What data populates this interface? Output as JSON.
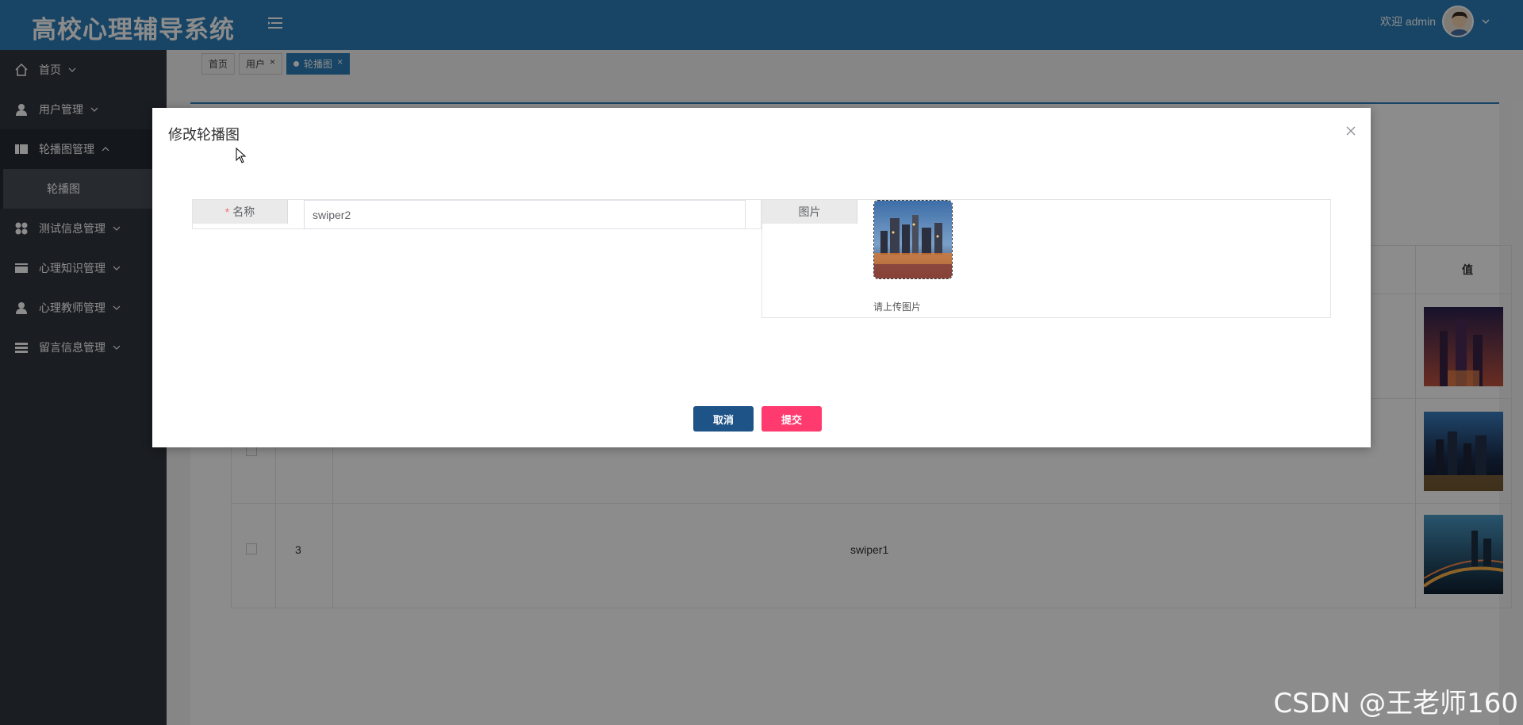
{
  "header": {
    "title": "高校心理辅导系统",
    "welcome": "欢迎 admin"
  },
  "sidebar": {
    "items": [
      {
        "label": "首页"
      },
      {
        "label": "用户管理"
      },
      {
        "label": "轮播图管理"
      },
      {
        "label": "测试信息管理"
      },
      {
        "label": "心理知识管理"
      },
      {
        "label": "心理教师管理"
      },
      {
        "label": "留言信息管理"
      }
    ],
    "sub_item": "轮播图"
  },
  "tabs": [
    {
      "label": "首页"
    },
    {
      "label": "用户"
    },
    {
      "label": "轮播图"
    }
  ],
  "table": {
    "value_header": "值",
    "rows": [
      {
        "num": "",
        "name": ""
      },
      {
        "num": "",
        "name": ""
      },
      {
        "num": "3",
        "name": "swiper1"
      }
    ]
  },
  "modal": {
    "title": "修改轮播图",
    "name_label": "名称",
    "name_value": "swiper2",
    "image_label": "图片",
    "upload_tip": "请上传图片",
    "cancel_label": "取消",
    "submit_label": "提交"
  },
  "watermark": "CSDN @王老师160",
  "colors": {
    "header": "#2c7fb8",
    "sidebar": "#30353d",
    "cancel": "#1e5388",
    "submit": "#ff3a6e"
  }
}
